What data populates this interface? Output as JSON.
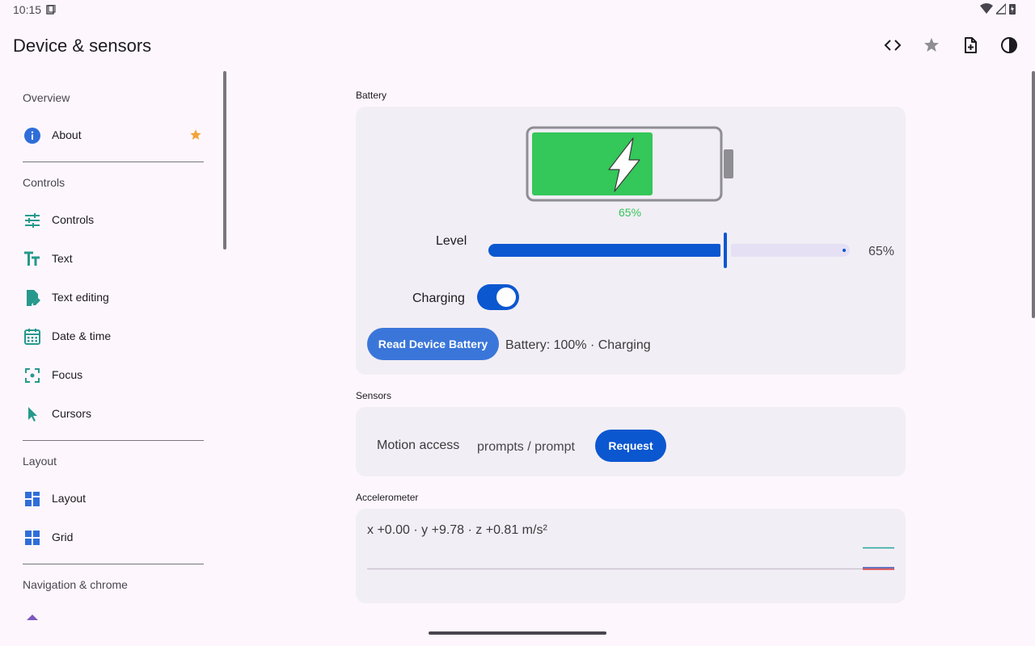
{
  "status": {
    "time": "10:15"
  },
  "app": {
    "title": "Device & sensors"
  },
  "toolbar": {
    "icons": [
      "code-icon",
      "star-icon",
      "add-document-icon",
      "contrast-icon"
    ]
  },
  "sidebar": {
    "sections": [
      {
        "header": "Overview",
        "items": [
          {
            "label": "About",
            "icon": "info-icon",
            "starred": true
          }
        ]
      },
      {
        "header": "Controls",
        "items": [
          {
            "label": "Controls",
            "icon": "tune-icon"
          },
          {
            "label": "Text",
            "icon": "text-fields-icon"
          },
          {
            "label": "Text editing",
            "icon": "edit-document-icon"
          },
          {
            "label": "Date & time",
            "icon": "calendar-icon"
          },
          {
            "label": "Focus",
            "icon": "focus-icon"
          },
          {
            "label": "Cursors",
            "icon": "cursor-icon"
          }
        ]
      },
      {
        "header": "Layout",
        "items": [
          {
            "label": "Layout",
            "icon": "dashboard-icon"
          },
          {
            "label": "Grid",
            "icon": "grid-icon"
          }
        ]
      },
      {
        "header": "Navigation & chrome",
        "items": []
      }
    ]
  },
  "battery": {
    "section_label": "Battery",
    "level_fraction": 0.65,
    "percent_label": "65%",
    "level_label": "Level",
    "slider_value": "65%",
    "charging_label": "Charging",
    "charging_on": true,
    "read_button": "Read Device Battery",
    "read_result": "Battery: 100% · Charging",
    "fill_color": "#34c759"
  },
  "sensors": {
    "section_label": "Sensors",
    "motion_label": "Motion access",
    "motion_status": "prompts / prompt",
    "request_button": "Request"
  },
  "accelerometer": {
    "section_label": "Accelerometer",
    "readout": "x +0.00 · y +9.78 · z +0.81 m/s²",
    "series_colors": [
      "#26a69a",
      "#3f51b5",
      "#e53935"
    ]
  },
  "colors": {
    "accent": "#0b57d0",
    "button": "#3a76d9",
    "teal_icon": "#26998c",
    "blue_icon": "#2f6ed8",
    "star": "#f2a33a"
  }
}
